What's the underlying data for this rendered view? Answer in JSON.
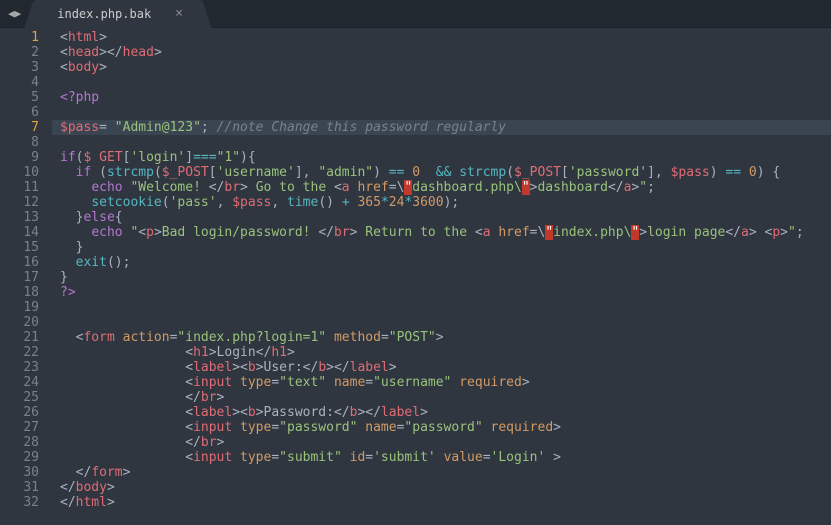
{
  "titlebar": {
    "nav_back_icon": "◀",
    "nav_fwd_icon": "▶",
    "tab_title": "index.php.bak",
    "tab_close_glyph": "×"
  },
  "gutter": {
    "start": 1,
    "end": 32,
    "orange_lines": [
      1,
      7
    ]
  },
  "code": {
    "lines": [
      {
        "n": 1,
        "segs": [
          [
            "pn",
            "<"
          ],
          [
            "tag",
            "html"
          ],
          [
            "pn",
            ">"
          ]
        ]
      },
      {
        "n": 2,
        "segs": [
          [
            "pn",
            "<"
          ],
          [
            "tag",
            "head"
          ],
          [
            "pn",
            "></"
          ],
          [
            "tag",
            "head"
          ],
          [
            "pn",
            ">"
          ]
        ]
      },
      {
        "n": 3,
        "segs": [
          [
            "pn",
            "<"
          ],
          [
            "tag",
            "body"
          ],
          [
            "pn",
            ">"
          ]
        ]
      },
      {
        "n": 4,
        "segs": []
      },
      {
        "n": 5,
        "segs": [
          [
            "kw",
            "<?php"
          ]
        ]
      },
      {
        "n": 6,
        "segs": []
      },
      {
        "n": 7,
        "hl": true,
        "segs": [
          [
            "var",
            "$pass"
          ],
          [
            "pn",
            "= "
          ],
          [
            "st",
            "\"Admin@123\""
          ],
          [
            "pn",
            "; "
          ],
          [
            "cm",
            "//note Change this password regularly"
          ]
        ]
      },
      {
        "n": 8,
        "segs": []
      },
      {
        "n": 9,
        "segs": [
          [
            "kw",
            "if"
          ],
          [
            "pn",
            "("
          ],
          [
            "var",
            "$ GET"
          ],
          [
            "pn",
            "["
          ],
          [
            "st",
            "'login'"
          ],
          [
            "pn",
            "]"
          ],
          [
            "op",
            "==="
          ],
          [
            "st",
            "\"1\""
          ],
          [
            "pn",
            "){"
          ]
        ]
      },
      {
        "n": 10,
        "indent": "  ",
        "segs": [
          [
            "kw",
            "if"
          ],
          [
            "pn",
            " ("
          ],
          [
            "fn",
            "strcmp"
          ],
          [
            "pn",
            "("
          ],
          [
            "var",
            "$_POST"
          ],
          [
            "pn",
            "["
          ],
          [
            "st",
            "'username'"
          ],
          [
            "pn",
            "], "
          ],
          [
            "st",
            "\"admin\""
          ],
          [
            "pn",
            ") "
          ],
          [
            "op",
            "=="
          ],
          [
            "pn",
            " "
          ],
          [
            "nm",
            "0"
          ],
          [
            "pn",
            "  "
          ],
          [
            "op",
            "&&"
          ],
          [
            "pn",
            " "
          ],
          [
            "fn",
            "strcmp"
          ],
          [
            "pn",
            "("
          ],
          [
            "var",
            "$_POST"
          ],
          [
            "pn",
            "["
          ],
          [
            "st",
            "'password'"
          ],
          [
            "pn",
            "], "
          ],
          [
            "var",
            "$pass"
          ],
          [
            "pn",
            ") "
          ],
          [
            "op",
            "=="
          ],
          [
            "pn",
            " "
          ],
          [
            "nm",
            "0"
          ],
          [
            "pn",
            ") {"
          ]
        ]
      },
      {
        "n": 11,
        "indent": "    ",
        "segs": [
          [
            "kw",
            "echo"
          ],
          [
            "pn",
            " "
          ],
          [
            "st",
            "\"Welcome! "
          ],
          [
            "pn",
            "</"
          ],
          [
            "tag",
            "br"
          ],
          [
            "pn",
            ">"
          ],
          [
            "st",
            " Go to the "
          ],
          [
            "pn",
            "<"
          ],
          [
            "tag",
            "a"
          ],
          [
            "pn",
            " "
          ],
          [
            "attr",
            "href"
          ],
          [
            "pn",
            "=\\"
          ],
          [
            "errbg",
            "\""
          ],
          [
            "st",
            "dashboard.php\\"
          ],
          [
            "errbg",
            "\""
          ],
          [
            "pn",
            ">"
          ],
          [
            "st",
            "dashboard"
          ],
          [
            "pn",
            "</"
          ],
          [
            "tag",
            "a"
          ],
          [
            "pn",
            ">"
          ],
          [
            "st",
            "\""
          ],
          [
            "pn",
            ";"
          ]
        ]
      },
      {
        "n": 12,
        "indent": "    ",
        "segs": [
          [
            "fn",
            "setcookie"
          ],
          [
            "pn",
            "("
          ],
          [
            "st",
            "'pass'"
          ],
          [
            "pn",
            ", "
          ],
          [
            "var",
            "$pass"
          ],
          [
            "pn",
            ", "
          ],
          [
            "fn",
            "time"
          ],
          [
            "pn",
            "() "
          ],
          [
            "op",
            "+"
          ],
          [
            "pn",
            " "
          ],
          [
            "nm",
            "365"
          ],
          [
            "op",
            "*"
          ],
          [
            "nm",
            "24"
          ],
          [
            "op",
            "*"
          ],
          [
            "nm",
            "3600"
          ],
          [
            "pn",
            ");"
          ]
        ]
      },
      {
        "n": 13,
        "indent": "  ",
        "segs": [
          [
            "pn",
            "}"
          ],
          [
            "kw",
            "else"
          ],
          [
            "pn",
            "{"
          ]
        ]
      },
      {
        "n": 14,
        "indent": "    ",
        "segs": [
          [
            "kw",
            "echo"
          ],
          [
            "pn",
            " "
          ],
          [
            "st",
            "\""
          ],
          [
            "pn",
            "<"
          ],
          [
            "tag",
            "p"
          ],
          [
            "pn",
            ">"
          ],
          [
            "st",
            "Bad login/password! "
          ],
          [
            "pn",
            "</"
          ],
          [
            "tag",
            "br"
          ],
          [
            "pn",
            ">"
          ],
          [
            "st",
            " Return to the "
          ],
          [
            "pn",
            "<"
          ],
          [
            "tag",
            "a"
          ],
          [
            "pn",
            " "
          ],
          [
            "attr",
            "href"
          ],
          [
            "pn",
            "=\\"
          ],
          [
            "errbg",
            "\""
          ],
          [
            "st",
            "index.php\\"
          ],
          [
            "errbg",
            "\""
          ],
          [
            "pn",
            ">"
          ],
          [
            "st",
            "login page"
          ],
          [
            "pn",
            "</"
          ],
          [
            "tag",
            "a"
          ],
          [
            "pn",
            "> <"
          ],
          [
            "tag",
            "p"
          ],
          [
            "pn",
            ">"
          ],
          [
            "st",
            "\""
          ],
          [
            "pn",
            ";"
          ]
        ]
      },
      {
        "n": 15,
        "indent": "  ",
        "segs": [
          [
            "pn",
            "}"
          ]
        ]
      },
      {
        "n": 16,
        "indent": "  ",
        "segs": [
          [
            "fn",
            "exit"
          ],
          [
            "pn",
            "();"
          ]
        ]
      },
      {
        "n": 17,
        "segs": [
          [
            "pn",
            "}"
          ]
        ]
      },
      {
        "n": 18,
        "segs": [
          [
            "kw",
            "?>"
          ]
        ]
      },
      {
        "n": 19,
        "segs": []
      },
      {
        "n": 20,
        "segs": []
      },
      {
        "n": 21,
        "indent": "  ",
        "segs": [
          [
            "pn",
            "<"
          ],
          [
            "tag",
            "form"
          ],
          [
            "pn",
            " "
          ],
          [
            "attr",
            "action"
          ],
          [
            "pn",
            "="
          ],
          [
            "st",
            "\"index.php?login=1\""
          ],
          [
            "pn",
            " "
          ],
          [
            "attr",
            "method"
          ],
          [
            "pn",
            "="
          ],
          [
            "st",
            "\"POST\""
          ],
          [
            "pn",
            ">"
          ]
        ]
      },
      {
        "n": 22,
        "indent": "                ",
        "segs": [
          [
            "pn",
            "<"
          ],
          [
            "tag",
            "h1"
          ],
          [
            "pn",
            ">"
          ],
          [
            "txt",
            "Login"
          ],
          [
            "pn",
            "</"
          ],
          [
            "tag",
            "h1"
          ],
          [
            "pn",
            ">"
          ]
        ]
      },
      {
        "n": 23,
        "indent": "                ",
        "segs": [
          [
            "pn",
            "<"
          ],
          [
            "tag",
            "label"
          ],
          [
            "pn",
            "><"
          ],
          [
            "tag",
            "b"
          ],
          [
            "pn",
            ">"
          ],
          [
            "txt",
            "User:"
          ],
          [
            "pn",
            "</"
          ],
          [
            "tag",
            "b"
          ],
          [
            "pn",
            "></"
          ],
          [
            "tag",
            "label"
          ],
          [
            "pn",
            ">"
          ]
        ]
      },
      {
        "n": 24,
        "indent": "                ",
        "segs": [
          [
            "pn",
            "<"
          ],
          [
            "tag",
            "input"
          ],
          [
            "pn",
            " "
          ],
          [
            "attr",
            "type"
          ],
          [
            "pn",
            "="
          ],
          [
            "st",
            "\"text\""
          ],
          [
            "pn",
            " "
          ],
          [
            "attr",
            "name"
          ],
          [
            "pn",
            "="
          ],
          [
            "st",
            "\"username\""
          ],
          [
            "pn",
            " "
          ],
          [
            "attr",
            "required"
          ],
          [
            "pn",
            ">"
          ]
        ]
      },
      {
        "n": 25,
        "indent": "                ",
        "segs": [
          [
            "pn",
            "</"
          ],
          [
            "tag",
            "br"
          ],
          [
            "pn",
            ">"
          ]
        ]
      },
      {
        "n": 26,
        "indent": "                ",
        "segs": [
          [
            "pn",
            "<"
          ],
          [
            "tag",
            "label"
          ],
          [
            "pn",
            "><"
          ],
          [
            "tag",
            "b"
          ],
          [
            "pn",
            ">"
          ],
          [
            "txt",
            "Password:"
          ],
          [
            "pn",
            "</"
          ],
          [
            "tag",
            "b"
          ],
          [
            "pn",
            "></"
          ],
          [
            "tag",
            "label"
          ],
          [
            "pn",
            ">"
          ]
        ]
      },
      {
        "n": 27,
        "indent": "                ",
        "segs": [
          [
            "pn",
            "<"
          ],
          [
            "tag",
            "input"
          ],
          [
            "pn",
            " "
          ],
          [
            "attr",
            "type"
          ],
          [
            "pn",
            "="
          ],
          [
            "st",
            "\"password\""
          ],
          [
            "pn",
            " "
          ],
          [
            "attr",
            "name"
          ],
          [
            "pn",
            "="
          ],
          [
            "st",
            "\"password\""
          ],
          [
            "pn",
            " "
          ],
          [
            "attr",
            "required"
          ],
          [
            "pn",
            ">"
          ]
        ]
      },
      {
        "n": 28,
        "indent": "                ",
        "segs": [
          [
            "pn",
            "</"
          ],
          [
            "tag",
            "br"
          ],
          [
            "pn",
            ">"
          ]
        ]
      },
      {
        "n": 29,
        "indent": "                ",
        "segs": [
          [
            "pn",
            "<"
          ],
          [
            "tag",
            "input"
          ],
          [
            "pn",
            " "
          ],
          [
            "attr",
            "type"
          ],
          [
            "pn",
            "="
          ],
          [
            "st",
            "\"submit\""
          ],
          [
            "pn",
            " "
          ],
          [
            "attr",
            "id"
          ],
          [
            "pn",
            "="
          ],
          [
            "st",
            "'submit'"
          ],
          [
            "pn",
            " "
          ],
          [
            "attr",
            "value"
          ],
          [
            "pn",
            "="
          ],
          [
            "st",
            "'Login'"
          ],
          [
            "pn",
            " >"
          ]
        ]
      },
      {
        "n": 30,
        "indent": "  ",
        "segs": [
          [
            "pn",
            "</"
          ],
          [
            "tag",
            "form"
          ],
          [
            "pn",
            ">"
          ]
        ]
      },
      {
        "n": 31,
        "segs": [
          [
            "pn",
            "</"
          ],
          [
            "tag",
            "body"
          ],
          [
            "pn",
            ">"
          ]
        ]
      },
      {
        "n": 32,
        "segs": [
          [
            "pn",
            "</"
          ],
          [
            "tag",
            "html"
          ],
          [
            "pn",
            ">"
          ]
        ]
      }
    ]
  }
}
